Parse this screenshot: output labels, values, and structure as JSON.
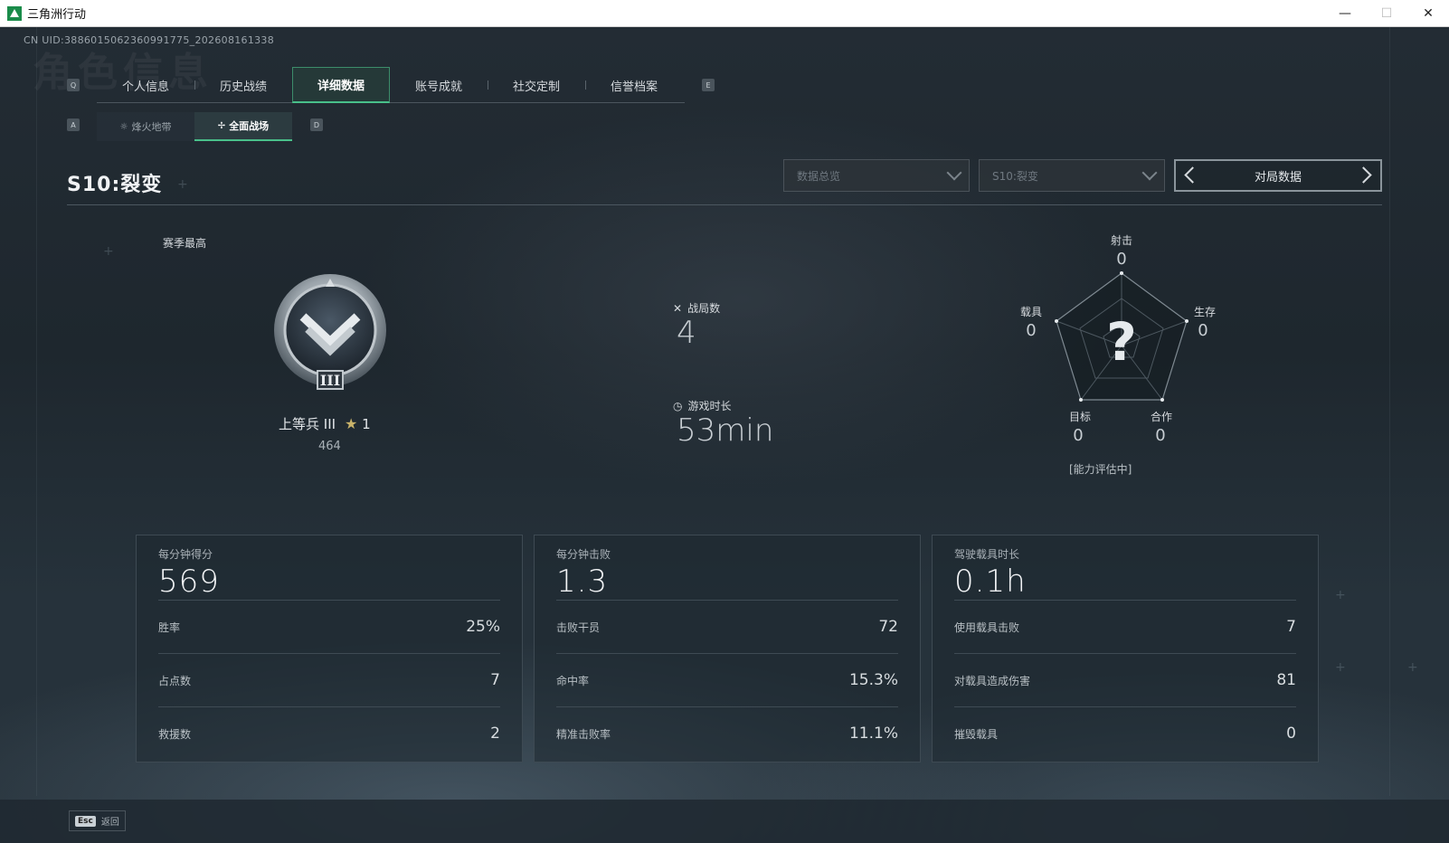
{
  "window": {
    "title": "三角洲行动",
    "controls": {
      "minimize": "—",
      "maximize": "☐",
      "close": "✕"
    }
  },
  "uid": "CN UID:3886015062360991775_202608161338",
  "background_heading": "角色信息",
  "tabs": {
    "left_key": "Q",
    "right_key": "E",
    "items": [
      {
        "label": "个人信息",
        "active": false
      },
      {
        "label": "历史战绩",
        "active": false
      },
      {
        "label": "详细数据",
        "active": true
      },
      {
        "label": "账号成就",
        "active": false
      },
      {
        "label": "社交定制",
        "active": false
      },
      {
        "label": "信誉档案",
        "active": false
      }
    ]
  },
  "subtabs": {
    "left_key": "A",
    "right_key": "D",
    "items": [
      {
        "label": "烽火地带",
        "icon": "sun-icon",
        "active": false
      },
      {
        "label": "全面战场",
        "icon": "crosshair-icon",
        "active": true
      }
    ]
  },
  "season": {
    "title": "S10:裂变"
  },
  "filters": {
    "data_type": "数据总览",
    "season_select": "S10:裂变",
    "pager_label": "对局数据"
  },
  "rank": {
    "section_label": "赛季最高",
    "name": "上等兵 III",
    "stars": "1",
    "score": "464",
    "icon": "chevron-rank-badge"
  },
  "summary": {
    "matches_label": "战局数",
    "matches_value": "4",
    "playtime_label": "游戏时长",
    "playtime_value": "53min"
  },
  "radar": {
    "axes": [
      {
        "label": "射击",
        "value": "0"
      },
      {
        "label": "生存",
        "value": "0"
      },
      {
        "label": "合作",
        "value": "0"
      },
      {
        "label": "目标",
        "value": "0"
      },
      {
        "label": "载具",
        "value": "0"
      }
    ],
    "center_mark": "?",
    "status": "[能力评估中]"
  },
  "cards": [
    {
      "head_label": "每分钟得分",
      "head_value": "569",
      "rows": [
        {
          "label": "胜率",
          "value": "25%"
        },
        {
          "label": "占点数",
          "value": "7"
        },
        {
          "label": "救援数",
          "value": "2"
        }
      ]
    },
    {
      "head_label": "每分钟击败",
      "head_value": "1.3",
      "rows": [
        {
          "label": "击败干员",
          "value": "72"
        },
        {
          "label": "命中率",
          "value": "15.3%"
        },
        {
          "label": "精准击败率",
          "value": "11.1%"
        }
      ]
    },
    {
      "head_label": "驾驶载具时长",
      "head_value": "0.1h",
      "rows": [
        {
          "label": "使用载具击败",
          "value": "7"
        },
        {
          "label": "对载具造成伤害",
          "value": "81"
        },
        {
          "label": "摧毁载具",
          "value": "0"
        }
      ]
    }
  ],
  "footer": {
    "esc_key": "Esc",
    "back_label": "返回"
  },
  "colors": {
    "accent": "#49c08a",
    "background": "#1f282f",
    "titlebar": "#ffffff"
  }
}
